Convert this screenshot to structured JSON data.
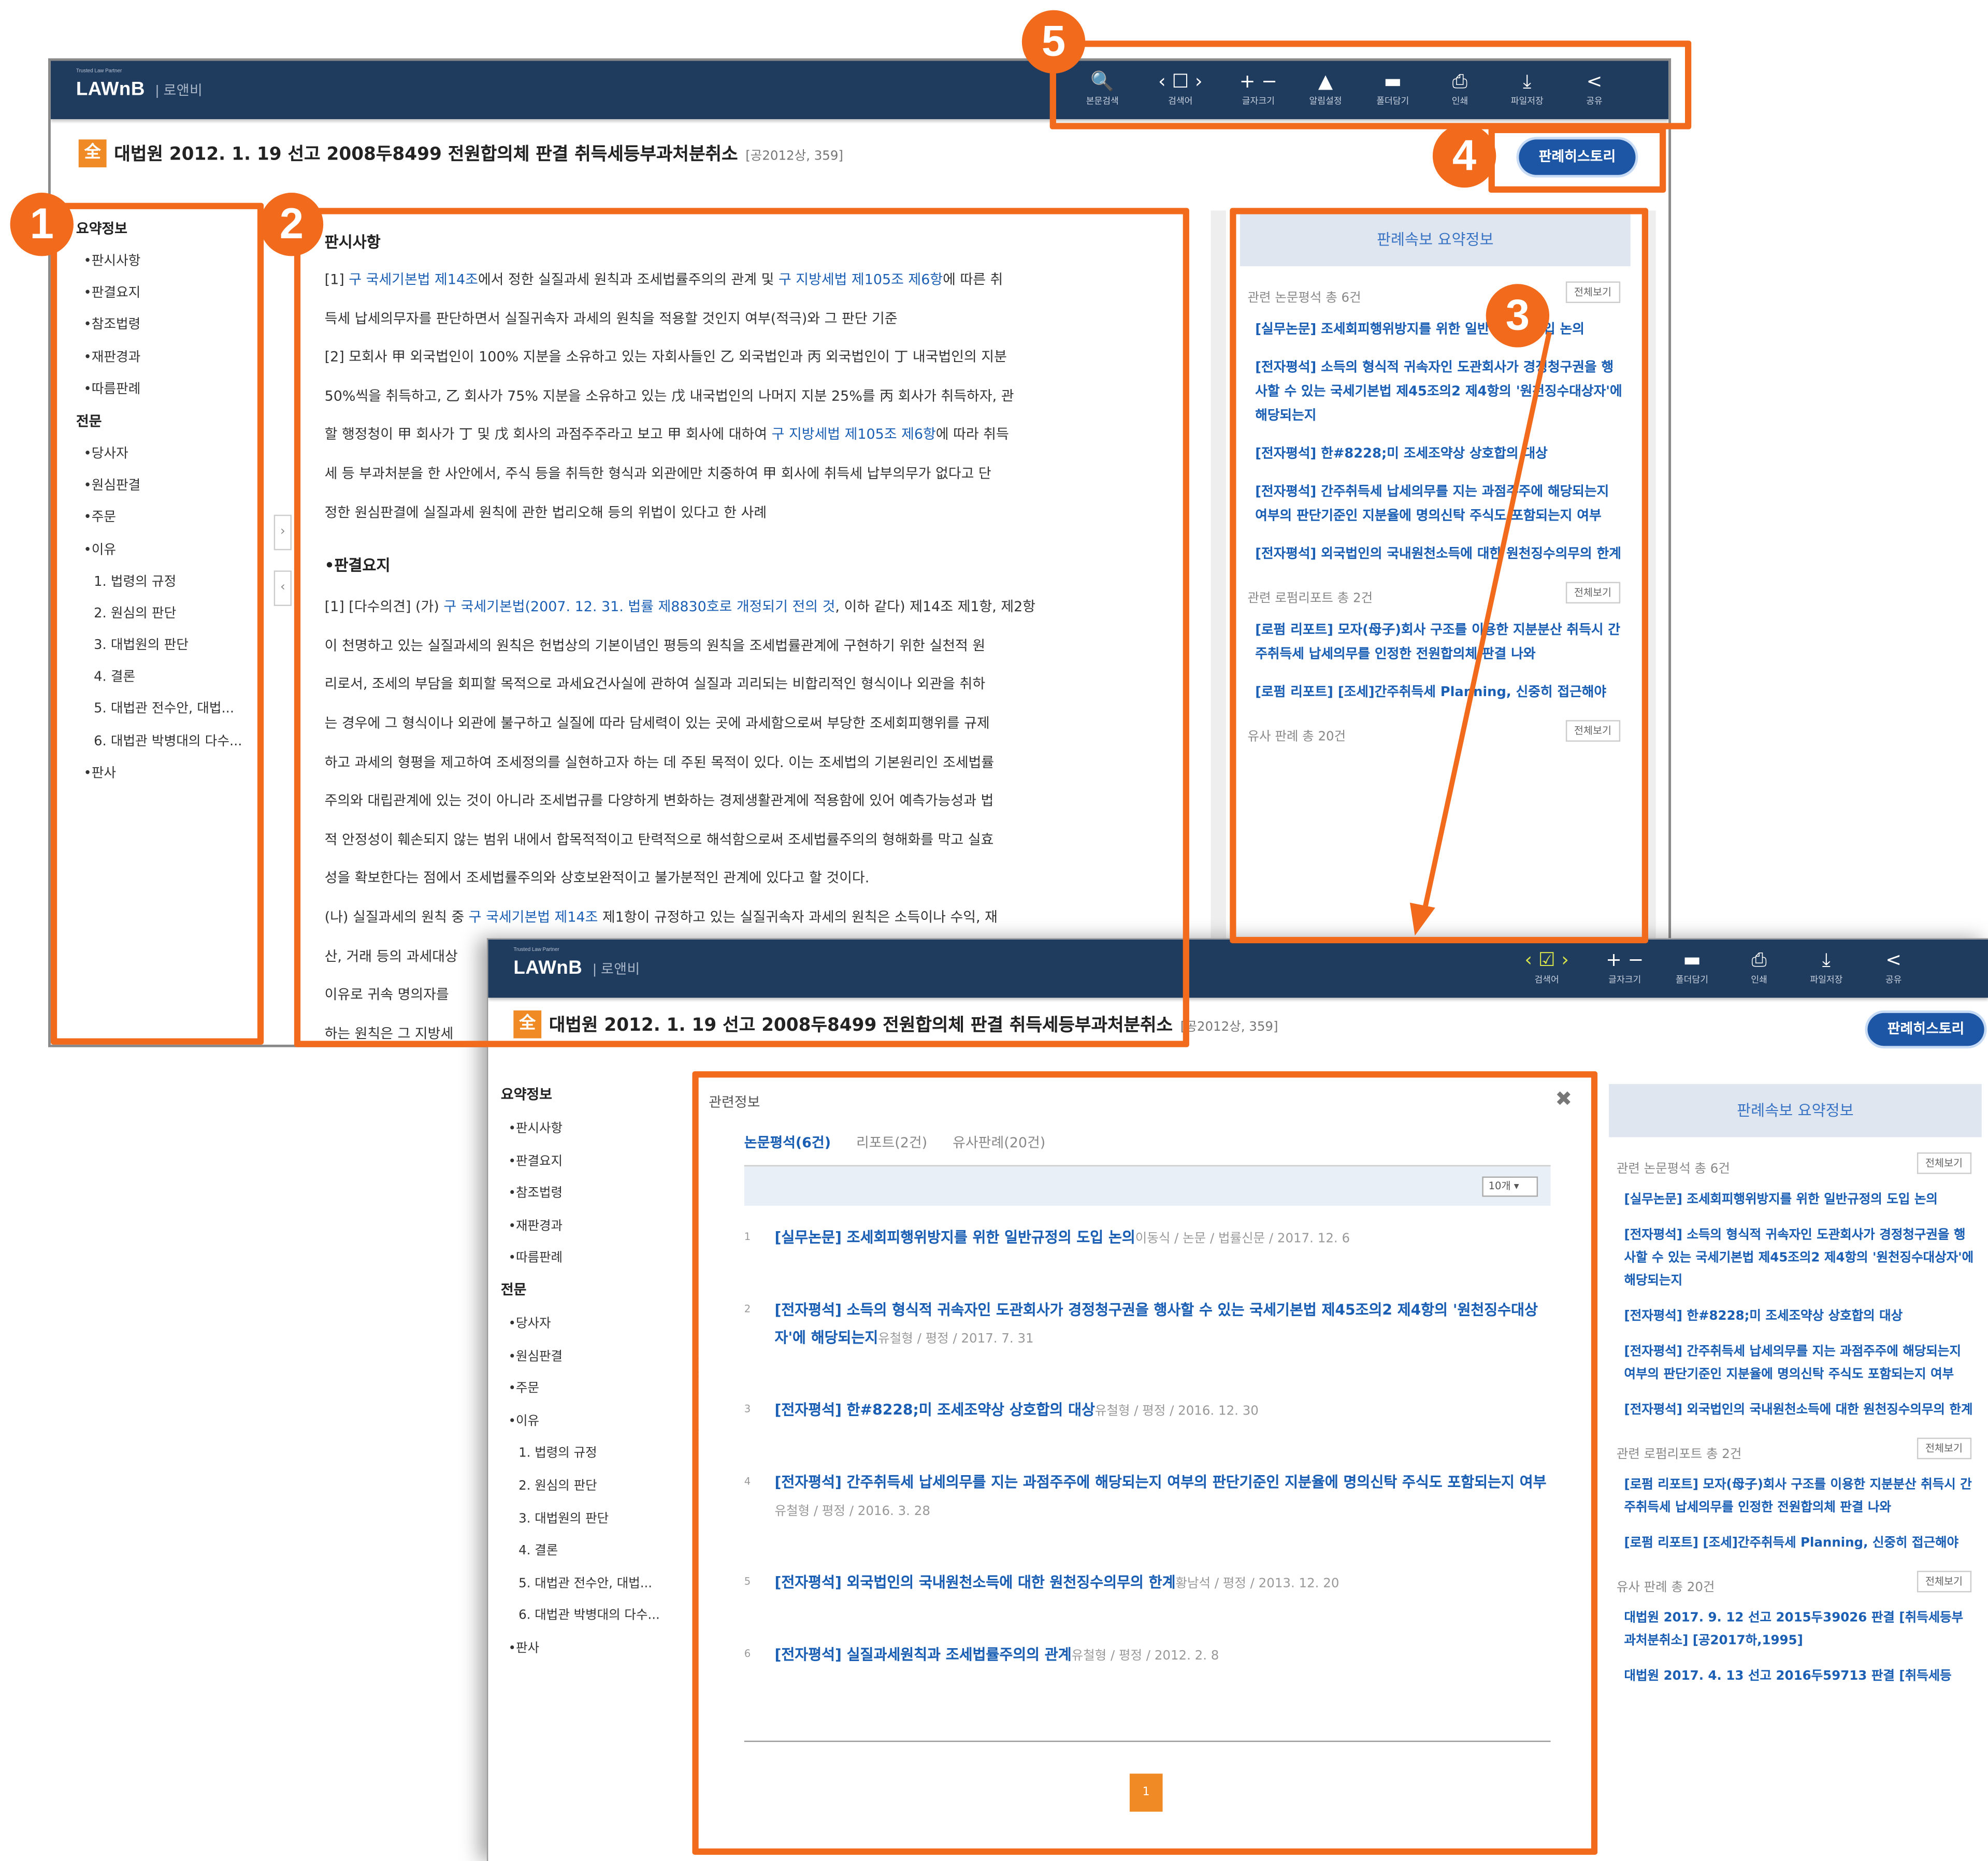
{
  "app": {
    "logo_top": "Trusted Law Partner",
    "logo": "LAWnB",
    "logo_sub": "로앤비"
  },
  "toolbar1": [
    {
      "icon": "search-icon",
      "glyph": "🔍",
      "label": "본문검색"
    },
    {
      "icon": "find-nav-icon",
      "glyph": "‹ ☐ ›",
      "label": "검색어"
    },
    {
      "icon": "zoom-icon",
      "glyph": "+ −",
      "label": "글자크기"
    },
    {
      "icon": "bell-icon",
      "glyph": "▲",
      "label": "알림설정"
    },
    {
      "icon": "folder-icon",
      "glyph": "▬",
      "label": "폴더담기"
    },
    {
      "icon": "print-icon",
      "glyph": "⎙",
      "label": "인쇄"
    },
    {
      "icon": "download-icon",
      "glyph": "⤓",
      "label": "파일저장"
    },
    {
      "icon": "share-icon",
      "glyph": "<",
      "label": "공유"
    }
  ],
  "toolbar2": [
    {
      "icon": "find-nav-icon",
      "glyph": "‹ ☑ ›",
      "label": "검색어"
    },
    {
      "icon": "zoom-icon",
      "glyph": "+ −",
      "label": "글자크기"
    },
    {
      "icon": "folder-icon",
      "glyph": "▬",
      "label": "폴더담기"
    },
    {
      "icon": "print-icon",
      "glyph": "⎙",
      "label": "인쇄"
    },
    {
      "icon": "download-icon",
      "glyph": "⤓",
      "label": "파일저장"
    },
    {
      "icon": "share-icon",
      "glyph": "<",
      "label": "공유"
    }
  ],
  "doc": {
    "badge": "全",
    "title": "대법원 2012. 1. 19 선고 2008두8499 전원합의체 판결 취득세등부과처분취소",
    "citation": "[공2012상, 359]",
    "history_button": "판례히스토리"
  },
  "sidebar": {
    "summary_head": "요약정보",
    "summary_items": [
      "•판시사항",
      "•판결요지",
      "•참조법령",
      "•재판경과",
      "•따름판례"
    ],
    "full_head": "전문",
    "full_items": [
      "•당사자",
      "•원심판결",
      "•주문",
      "•이유"
    ],
    "reason_items": [
      "1. 법령의 규정",
      "2. 원심의 판단",
      "3. 대법원의 판단",
      "4. 결론",
      "5. 대법관 전수안, 대법...",
      "6. 대법관 박병대의 다수..."
    ],
    "last_item": "•판사"
  },
  "content": {
    "h1": "판시사항",
    "p1": [
      "[1] 구 국세기본법 제14조에서 정한 실질과세 원칙과 조세법률주의의 관계 및 구 지방세법 제105조 제6항에 따른 취",
      "득세 납세의무자를 판단하면서 실질귀속자 과세의 원칙을 적용할 것인지 여부(적극)와 그 판단 기준",
      "[2] 모회사 甲 외국법인이 100% 지분을 소유하고 있는 자회사들인 乙 외국법인과 丙 외국법인이 丁 내국법인의 지분",
      "50%씩을 취득하고, 乙 회사가 75% 지분을 소유하고 있는 戊 내국법인의 나머지 지분 25%를 丙 회사가 취득하자, 관",
      "할 행정청이 甲 회사가 丁 및 戊 회사의 과점주주라고 보고 甲 회사에 대하여 구 지방세법 제105조 제6항에 따라 취득",
      "세 등 부과처분을 한 사안에서, 주식 등을 취득한 형식과 외관에만 치중하여 甲 회사에 취득세 납부의무가 없다고 단",
      "정한 원심판결에 실질과세 원칙에 관한 법리오해 등의 위법이 있다고 한 사례"
    ],
    "h2": "•판결요지",
    "p2": [
      "[1] [다수의견] (가) 구 국세기본법(2007. 12. 31. 법률 제8830호로 개정되기 전의 것, 이하 같다) 제14조 제1항, 제2항",
      "이 천명하고 있는 실질과세의 원칙은 헌법상의 기본이념인 평등의 원칙을 조세법률관계에 구현하기 위한 실천적 원",
      "리로서, 조세의 부담을 회피할 목적으로 과세요건사실에 관하여 실질과 괴리되는 비합리적인 형식이나 외관을 취하",
      "는 경우에 그 형식이나 외관에 불구하고 실질에 따라 담세력이 있는 곳에 과세함으로써 부당한 조세회피행위를 규제",
      "하고 과세의 형평을 제고하여 조세정의를 실현하고자 하는 데 주된 목적이 있다. 이는 조세법의 기본원리인 조세법률",
      "주의와 대립관계에 있는 것이 아니라 조세법규를 다양하게 변화하는 경제생활관계에 적용함에 있어 예측가능성과 법",
      "적 안정성이 훼손되지 않는 범위 내에서 합목적적이고 탄력적으로 해석함으로써 조세법률주의의 형해화를 막고 실효",
      "성을 확보한다는 점에서 조세법률주의와 상호보완적이고 불가분적인 관계에 있다고 할 것이다.",
      "(나) 실질과세의 원칙 중 구 국세기본법 제14조 제1항이 규정하고 있는 실질귀속자 과세의 원칙은 소득이나 수익, 재",
      "산, 거래 등의 과세대상",
      "이유로 귀속 명의자를",
      "하는 원칙은 그 지방세"
    ]
  },
  "right_panel": {
    "head": "판례속보 요약정보",
    "sec1": "관련 논문평석 총 6건",
    "sec1_items": [
      "[실무논문] 조세회피행위방지를 위한 일반규정의 도입 논의",
      "[전자평석] 소득의 형식적 귀속자인 도관회사가 경정청구권을 행사할 수 있는 국세기본법 제45조의2 제4항의 '원천징수대상자'에 해당되는지",
      "[전자평석] 한#8228;미 조세조약상 상호합의 대상",
      "[전자평석] 간주취득세 납세의무를 지는 과점주주에 해당되는지 여부의 판단기준인 지분율에 명의신탁 주식도 포함되는지 여부",
      "[전자평석] 외국법인의 국내원천소득에 대한 원천징수의무의 한계"
    ],
    "sec2": "관련 로펌리포트 총 2건",
    "sec2_items": [
      "[로펌 리포트] 모자(母子)회사 구조를 이용한 지분분산 취득시 간주취득세 납세의무를 인정한 전원합의체 판결 나와",
      "[로펌 리포트] [조세]간주취득세 Planning, 신중히 접근해야"
    ],
    "sec3": "유사 판례 총 20건",
    "sec3_items": [
      "대법원 2017. 9. 12 선고 2015두39026 판결 [취득세등부과처분취소] [공2017하,1995]",
      "대법원 2017. 4. 13 선고 2016두59713 판결 [취득세등"
    ],
    "view_all": "전체보기"
  },
  "modal": {
    "title": "관련정보",
    "close": "✖",
    "tabs": [
      "논문평석(6건)",
      "리포트(2건)",
      "유사판례(20건)"
    ],
    "per_page": "10개 ▾",
    "rows": [
      {
        "n": "1",
        "t": "[실무논문] 조세회피행위방지를 위한 일반규정의 도입 논의",
        "m": "이동식 / 논문 / 법률신문 / 2017. 12. 6"
      },
      {
        "n": "2",
        "t": "[전자평석] 소득의 형식적 귀속자인 도관회사가 경정청구권을 행사할 수 있는 국세기본법 제45조의2 제4항의 '원천징수대상자'에 해당되는지",
        "m": "유철형 / 평정 / 2017. 7. 31"
      },
      {
        "n": "3",
        "t": "[전자평석] 한#8228;미 조세조약상 상호합의 대상",
        "m": "유철형 / 평정 / 2016. 12. 30"
      },
      {
        "n": "4",
        "t": "[전자평석] 간주취득세 납세의무를 지는 과점주주에 해당되는지 여부의 판단기준인 지분율에 명의신탁 주식도 포함되는지 여부",
        "m": "유철형 / 평정 / 2016. 3. 28"
      },
      {
        "n": "5",
        "t": "[전자평석] 외국법인의 국내원천소득에 대한 원천징수의무의 한계",
        "m": "황남석 / 평정 / 2013. 12. 20"
      },
      {
        "n": "6",
        "t": "[전자평석] 실질과세원칙과 조세법률주의의 관계",
        "m": "유철형 / 평정 / 2012. 2. 8"
      }
    ],
    "page": "1"
  },
  "callouts": [
    "1",
    "2",
    "3",
    "4",
    "5"
  ],
  "colors": {
    "header": "#1f3c5f",
    "accent": "#f26b1d",
    "link": "#1a5fb4",
    "button": "#1d56a5"
  }
}
